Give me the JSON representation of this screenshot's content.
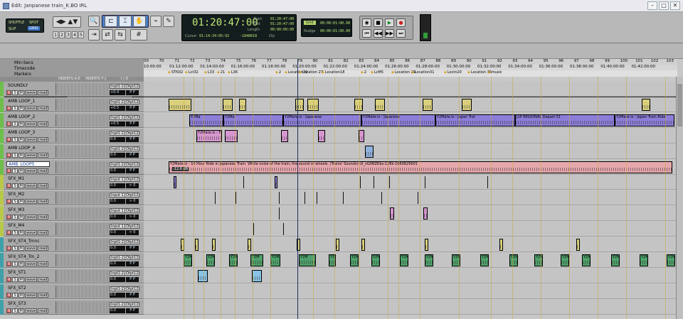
{
  "window": {
    "title": "Edit: Janpanese train_K.BO IRL",
    "buttons": [
      "–",
      "□",
      "✕"
    ]
  },
  "mode": {
    "shuffle": "SHUFFLE",
    "spot": "SPOT",
    "slip": "SLIP",
    "grid": "GRID",
    "nums": [
      "1",
      "2",
      "3",
      "4",
      "5"
    ]
  },
  "counter": {
    "main": "01:20:47:00",
    "cursor_label": "Cursor",
    "cursor": "01:14:34:05:92",
    "samples": "-1848018",
    "start_label": "Start",
    "start": "01:20:47:00",
    "end_label": "End",
    "end": "01:20:47:00",
    "length_label": "Length",
    "length": "00:00:00:00",
    "dly": "Dly"
  },
  "nudge": {
    "grid": "Grid",
    "grid_value": "00:00:01:00.00",
    "label": "Nudge",
    "value": "00:00:01:00.00"
  },
  "ruler": {
    "mins_label": "Min:Secs",
    "timecode_label": "Timecode",
    "markers_label": "Markers",
    "mins": [
      "00",
      "70",
      "71",
      "72",
      "73",
      "74",
      "75",
      "76",
      "77",
      "78",
      "79",
      "80",
      "81",
      "82",
      "83",
      "84",
      "85",
      "86",
      "87",
      "88",
      "89",
      "90",
      "91",
      "92",
      "93",
      "94",
      "95",
      "96",
      "97",
      "98",
      "99",
      "100",
      "101",
      "102",
      "103"
    ],
    "timecode": [
      "10:00:00",
      "01:12:00:00",
      "01:14:00:00",
      "01:16:00:00",
      "01:18:00:00",
      "01:20:00:00",
      "01:22:00:00",
      "01:24:00:00",
      "01:26:00:00",
      "01:28:00:00",
      "01:30:00:00",
      "01:32:00:00",
      "01:34:00:00",
      "01:36:00:00",
      "01:38:00:00",
      "01:40:00:00",
      "01:42:00:00"
    ],
    "markers": [
      "STN32",
      "Lct32",
      "L33",
      "21",
      "L36",
      "2",
      "Location39",
      "Location 27",
      "Location18",
      "2",
      "LcM5",
      "Location 29",
      "Location31",
      "Loctn20",
      "Location 36",
      "music"
    ]
  },
  "columns": {
    "inserts_ae": "INSERTS A-E",
    "inserts_fj": "INSERTS F-J",
    "io": "I / O"
  },
  "tracks": [
    {
      "name": "SOUNDLY",
      "color": "#6bbf4a",
      "in": "Inpt1-2",
      "out": "Otpt12",
      "vol": "+0.4",
      "pan": "P P"
    },
    {
      "name": "AMB LOOP_1",
      "color": "#6bbf4a",
      "in": "Inpt1-2",
      "out": "Otpt12",
      "vol": "+0.5",
      "pan": "P P"
    },
    {
      "name": "AMB LOOP_2",
      "color": "#6bbf4a",
      "in": "Inpt1-2",
      "out": "Otpt12",
      "vol": "+0.5",
      "pan": "P P"
    },
    {
      "name": "AMB LOOP_3",
      "color": "#6bbf4a",
      "in": "Inpt1-2",
      "out": "Otpt12",
      "vol": "0.0",
      "pan": "P P"
    },
    {
      "name": "AMB LOOP_4",
      "color": "#6bbf4a",
      "in": "Inpt1-2",
      "out": "Otpt12",
      "vol": "0.0",
      "pan": "P P"
    },
    {
      "name": "AMB_LOOP5",
      "color": "#6bbf4a",
      "in": "Inpt1-2",
      "out": "Otpt12",
      "vol": "0.0",
      "pan": "P P"
    },
    {
      "name": "SFX_M1",
      "color": "#b8c94a",
      "in": "Input 1",
      "out": "Otpt12",
      "vol": "0.0",
      "pan": "> 0"
    },
    {
      "name": "SFX_M2",
      "color": "#b8c94a",
      "in": "Input 1",
      "out": "Otpt12",
      "vol": "0.0",
      "pan": "> 0"
    },
    {
      "name": "SFX_M3",
      "color": "#b8c94a",
      "in": "Input 1",
      "out": "Otpt12",
      "vol": "0.0",
      "pan": "> 0"
    },
    {
      "name": "SFX_M4",
      "color": "#b8c94a",
      "in": "Input 1",
      "out": "Otpt12",
      "vol": "0.0",
      "pan": "> 0"
    },
    {
      "name": "SFX_ST4_Trnnc",
      "color": "#3fa0a8",
      "in": "Inpt1-2",
      "out": "Otpt12",
      "vol": "0.0",
      "pan": "P P"
    },
    {
      "name": "SFX_ST4_Trn_2",
      "color": "#3fa0a8",
      "in": "Inpt1-2",
      "out": "Otpt12",
      "vol": "0.0",
      "pan": "P P"
    },
    {
      "name": "SFX_ST1",
      "color": "#3fa0a8",
      "in": "Inpt1-2",
      "out": "Otpt12",
      "vol": "0.0",
      "pan": "P P"
    },
    {
      "name": "SFX_ST2",
      "color": "#3fa0a8",
      "in": "Inpt1-2",
      "out": "Otpt12",
      "vol": "0.0",
      "pan": "P P"
    },
    {
      "name": "SFX_ST3",
      "color": "#3fa0a8",
      "in": "Inpt1-2",
      "out": "Otpt12",
      "vol": "0.0",
      "pan": "P P"
    }
  ],
  "track_buttons": {
    "rec": "R",
    "solo": "S",
    "mute": "M",
    "view": "wave",
    "read": "read"
  },
  "clip_labels": {
    "amb2": [
      "Y2Ma",
      "Y2Mate.is - Japanese",
      "Y2Mate.is - Japan Trai",
      "J1P REGIONAL Depart:31",
      "Y2Mate.is - Japan Train Ride"
    ],
    "amb5": "Y2Mate.is - 10 Hour Ride in Japanese Train. White noise of the train, the sound of wheels. (Trains' Sounds)-Ul_vG0NZKbs-128k-1660825601",
    "amb5_gain": "-12.6 dB",
    "amb3": "Y2Mate.is - Train",
    "st": "Y2M"
  }
}
